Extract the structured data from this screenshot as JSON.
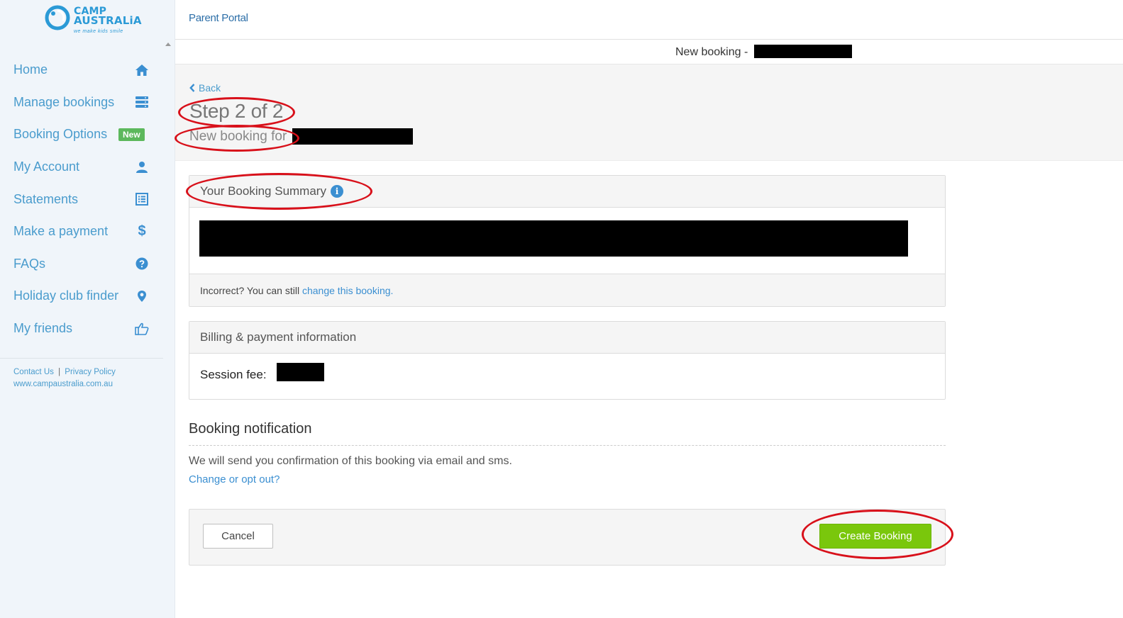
{
  "brand": {
    "logo_line1": "CAMP",
    "logo_line2": "AUSTRALiA",
    "logo_tagline": "we make kids smile"
  },
  "sidebar": {
    "items": [
      {
        "label": "Home",
        "icon": "home-icon"
      },
      {
        "label": "Manage bookings",
        "icon": "list-icon"
      },
      {
        "label": "Booking Options",
        "badge": "New"
      },
      {
        "label": "My Account",
        "icon": "user-icon"
      },
      {
        "label": "Statements",
        "icon": "statement-icon"
      },
      {
        "label": "Make a payment",
        "icon": "dollar-icon"
      },
      {
        "label": "FAQs",
        "icon": "question-icon"
      },
      {
        "label": "Holiday club finder",
        "icon": "map-pin-icon"
      },
      {
        "label": "My friends",
        "icon": "thumbs-up-icon"
      }
    ],
    "footer": {
      "contact": "Contact Us",
      "separator": "|",
      "privacy": "Privacy Policy",
      "website": "www.campaustralia.com.au"
    }
  },
  "header": {
    "title": "Parent Portal",
    "subtitle_prefix": "New booking -"
  },
  "hero": {
    "back_label": "Back",
    "step": "Step 2 of 2",
    "new_booking_for": "New booking for"
  },
  "summary": {
    "title": "Your Booking Summary",
    "footer_text": "Incorrect? You can still",
    "footer_link": "change this booking."
  },
  "billing": {
    "title": "Billing & payment information",
    "session_fee_label": "Session fee:"
  },
  "notification": {
    "title": "Booking notification",
    "text": "We will send you confirmation of this booking via email and sms.",
    "link": "Change or opt out?"
  },
  "actions": {
    "cancel_label": "Cancel",
    "create_label": "Create Booking"
  },
  "colors": {
    "accent_link": "#3b8fd1",
    "sidebar_text": "#4a9ccd",
    "create_button": "#7ac70c",
    "annotation_circle": "#d8101a",
    "badge_new": "#5cb85c"
  }
}
